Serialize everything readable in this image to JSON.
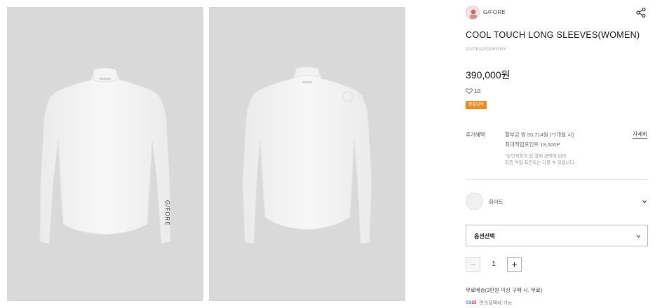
{
  "brand": {
    "name": "G/FORE",
    "logo_icon": "brand-avatar-icon"
  },
  "product": {
    "title": "COOL TOUCH LONG SLEEVES(WOMEN)",
    "code": "GNTBA25206WHX",
    "price": "390,000원",
    "likes": "10",
    "badge": "품절임박"
  },
  "images": [
    {
      "alt": "front view white long sleeve top"
    },
    {
      "alt": "back view white long sleeve top"
    }
  ],
  "benefits": {
    "label": "추가혜택",
    "installment": "할부금 원 55,714원 (*7개월 시)",
    "points": "최대적립포인트 19,500P",
    "note_line1": "*할인적용과 쉽 결제 금액에 따라",
    "note_line2": "최종 적립 포인트는 다를 수 있습니다.",
    "detail_link": "자세히"
  },
  "color": {
    "name": "화이트",
    "swatch_hex": "#f0f0f0"
  },
  "option_select": {
    "label": "옵션선택"
  },
  "quantity": {
    "value": "1",
    "minus": "−",
    "plus": "+"
  },
  "shipping": {
    "text": "무료배송(3만원 이상 구매 시, 무료)",
    "gs_logo_prefix": "GS",
    "gs_logo_suffix": "25",
    "gs_text": "편의점택배 가능"
  },
  "colors": {
    "badge": "#e98a22",
    "gs_blue": "#3a8bd6",
    "gs_red": "#d9232e",
    "photo_bg": "#d9d9d9"
  }
}
